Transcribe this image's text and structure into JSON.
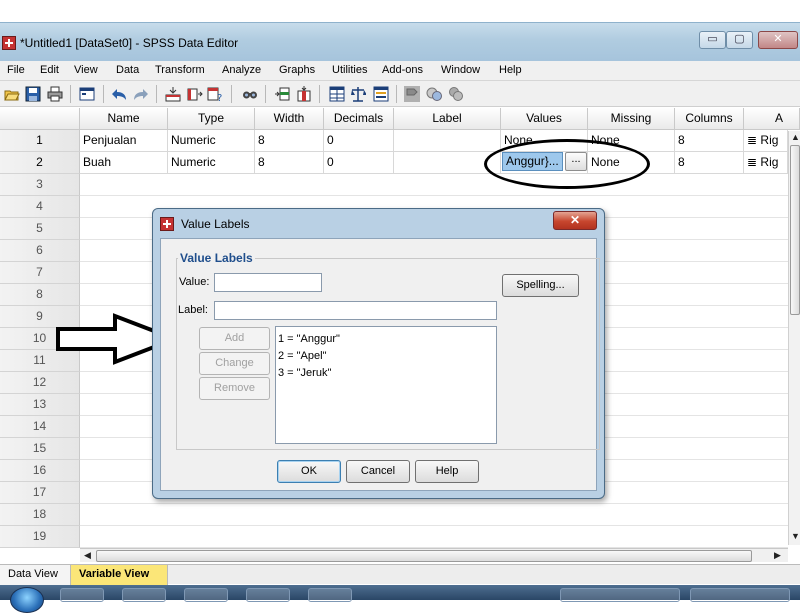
{
  "window": {
    "title": "*Untitled1 [DataSet0] - SPSS Data Editor",
    "buttons": {
      "minimize": "▭",
      "maximize": "▢",
      "close": "✕"
    }
  },
  "menu": [
    "File",
    "Edit",
    "View",
    "Data",
    "Transform",
    "Analyze",
    "Graphs",
    "Utilities",
    "Add-ons",
    "Window",
    "Help"
  ],
  "toolbar": {
    "icons": [
      "open-folder-icon",
      "save-icon",
      "print-icon",
      "dialog-recall-icon",
      "undo-icon",
      "redo-icon",
      "goto-case-icon",
      "goto-variable-icon",
      "variables-icon",
      "find-icon",
      "insert-cases-icon",
      "insert-variable-icon",
      "split-file-icon",
      "weight-cases-icon",
      "select-cases-icon",
      "value-labels-icon",
      "use-sets-icon",
      "show-all-variables-icon"
    ]
  },
  "grid": {
    "columns": [
      "",
      "Name",
      "Type",
      "Width",
      "Decimals",
      "Label",
      "Values",
      "Missing",
      "Columns",
      "A"
    ],
    "rows": [
      {
        "num": "1",
        "name": "Penjualan",
        "type": "Numeric",
        "width": "8",
        "decimals": "0",
        "label": "",
        "values": "None",
        "missing": "None",
        "columns": "8",
        "align": "Rig"
      },
      {
        "num": "2",
        "name": "Buah",
        "type": "Numeric",
        "width": "8",
        "decimals": "0",
        "label": "",
        "values": "Anggur}...",
        "missing": "None",
        "columns": "8",
        "align": "Rig"
      }
    ],
    "empty_row_numbers": [
      "3",
      "4",
      "5",
      "6",
      "7",
      "8",
      "9",
      "10",
      "11",
      "12",
      "13",
      "14",
      "15",
      "16",
      "17",
      "18",
      "19"
    ],
    "ellipsis_button": "..."
  },
  "tabs": {
    "data_view": "Data View",
    "variable_view": "Variable View",
    "active": "Variable View"
  },
  "dialog": {
    "title": "Value Labels",
    "close_label": "✕",
    "group_title": "Value Labels",
    "value_label": "Value:",
    "value_input": "",
    "label_label": "Label:",
    "label_input": "",
    "spelling_button": "Spelling...",
    "add_button": "Add",
    "change_button": "Change",
    "remove_button": "Remove",
    "list": [
      "1 = \"Anggur\"",
      "2 = \"Apel\"",
      "3 = \"Jeruk\""
    ],
    "ok_button": "OK",
    "cancel_button": "Cancel",
    "help_button": "Help"
  },
  "colors": {
    "selected_cell": "#9ec8ec",
    "active_tab": "#fbe678",
    "group_title": "#1f4e8c",
    "title_bar": "#b0cce0"
  }
}
